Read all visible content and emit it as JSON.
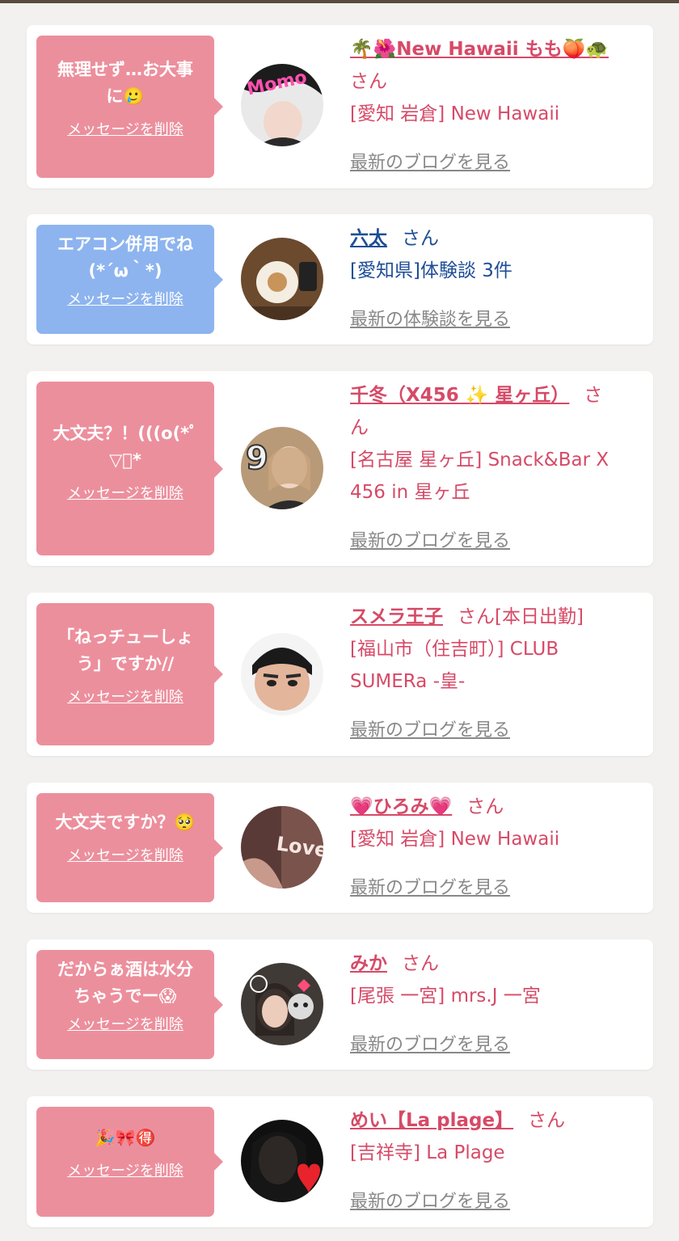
{
  "colors": {
    "pink_bubble": "#ec8f9d",
    "blue_bubble": "#8db4ef",
    "name_pink": "#d64a67",
    "name_blue": "#1e4d96",
    "link_gray": "#888888"
  },
  "delete_label": "メッセージを削除",
  "items": [
    {
      "message_lines": [
        "無理せず…お大事",
        "に🥲"
      ],
      "bubble": "pink",
      "avatar": "avatar-photo",
      "name": "🌴🌺New Hawaii もも🍑🐢",
      "suffix": "さん",
      "shop_lines": [
        "[愛知 岩倉] New Hawaii"
      ],
      "link": "最新のブログを見る"
    },
    {
      "message_lines": [
        "エアコン併用でね",
        "(*´ω｀*)"
      ],
      "bubble": "blue",
      "avatar": "avatar-photo",
      "name": "六太",
      "suffix": "さん",
      "shop_lines": [
        "[愛知県]体験談 3件"
      ],
      "link": "最新の体験談を見る"
    },
    {
      "message_lines": [
        "大文夫？！(((o(*ﾟ",
        "▽ﾟ*"
      ],
      "bubble": "pink",
      "avatar": "avatar-photo",
      "name": "千冬（X456 ✨ 星ヶ丘）",
      "suffix": "さ",
      "name_line2": "ん",
      "shop_lines": [
        "[名古屋 星ヶ丘] Snack&Bar X",
        "456 in 星ヶ丘"
      ],
      "link": "最新のブログを見る"
    },
    {
      "message_lines": [
        "「ねっチューしょ",
        "う」ですか//"
      ],
      "bubble": "pink",
      "avatar": "avatar-photo",
      "name": "スメラ王子",
      "suffix": "さん[本日出勤]",
      "shop_lines": [
        "[福山市（住吉町）] CLUB",
        "SUMERa -皇-"
      ],
      "link": "最新のブログを見る"
    },
    {
      "message_lines": [
        "大文夫ですか？🥺"
      ],
      "bubble": "pink",
      "avatar": "avatar-photo",
      "name": "💗ひろみ💗",
      "suffix": "さん",
      "shop_lines": [
        "[愛知 岩倉] New Hawaii"
      ],
      "link": "最新のブログを見る"
    },
    {
      "message_lines": [
        "だからぁ酒は水分",
        "ちゃうでー😱"
      ],
      "bubble": "pink",
      "avatar": "avatar-photo",
      "name": "みか",
      "suffix": "さん",
      "shop_lines": [
        "[尾張 一宮] mrs.J 一宮"
      ],
      "link": "最新のブログを見る"
    },
    {
      "message_lines": [
        "🎉🎀🉐"
      ],
      "bubble": "pink",
      "avatar": "avatar-photo",
      "name": "めい【La plage】",
      "suffix": "さん",
      "shop_lines": [
        "[吉祥寺] La Plage"
      ],
      "link": "最新のブログを見る"
    }
  ]
}
